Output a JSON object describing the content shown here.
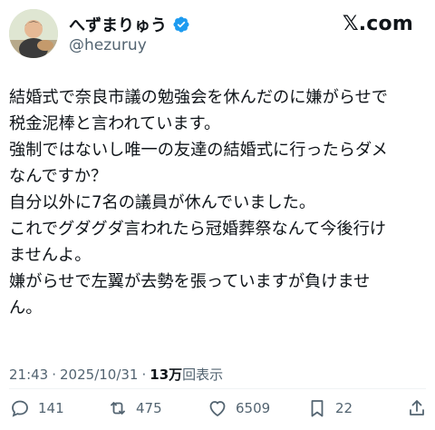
{
  "author": {
    "display_name": "へずまりゅう",
    "handle": "@hezuruy",
    "verified_color": "#1d9bf0"
  },
  "brand": "𝕏.com",
  "tweet": {
    "lines": [
      "結婚式で奈良市議の勉強会を休んだのに嫌がらせで",
      "税金泥棒と言われています。",
      "強制ではないし唯一の友達の結婚式に行ったらダメ",
      "なんですか？",
      "自分以外に7名の議員が休んでいました。",
      "これでグダグダ言われたら冠婚葬祭なんて今後行け",
      "ませんよ。",
      "嫌がらせで左翼が去勢を張っていますが負けませ",
      "ん。"
    ]
  },
  "meta": {
    "time": "21:43",
    "separator": "·",
    "date": "2025/10/31",
    "separator2": "·",
    "views_count": "13万",
    "views_label": "回表示"
  },
  "actions": {
    "reply_count": "141",
    "repost_count": "475",
    "like_count": "6509",
    "bookmark_count": "22"
  },
  "icons": [
    "reply-icon",
    "repost-icon",
    "like-icon",
    "bookmark-icon",
    "share-icon",
    "verified-badge-icon"
  ]
}
